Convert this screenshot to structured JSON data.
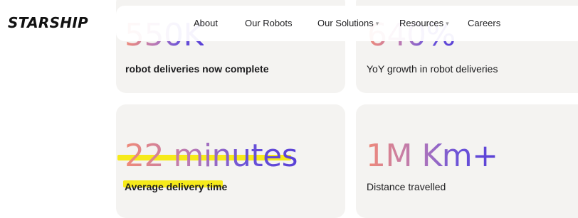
{
  "brand": {
    "name": "STARSHIP"
  },
  "nav": {
    "items": [
      {
        "label": "About"
      },
      {
        "label": "Our Robots"
      },
      {
        "label": "Our Solutions",
        "icon": "chevron-down-icon"
      },
      {
        "label": "Resources",
        "icon": "chevron-down-icon"
      },
      {
        "label": "Careers"
      }
    ],
    "chevron_glyph": "▾"
  },
  "stats": {
    "top_left": {
      "value": "550K",
      "label": "robot deliveries now complete"
    },
    "top_right": {
      "value": "640%",
      "label": "YoY growth in robot deliveries"
    },
    "bottom_left": {
      "value": "22 minutes",
      "label": "Average delivery time"
    },
    "bottom_right": {
      "value": "1M Km+",
      "label": "Distance travelled"
    }
  },
  "colors": {
    "card_background": "#f4f3f1",
    "gradient_start": "#f08a78",
    "gradient_end": "#5940d6",
    "highlight": "#f6ea1a",
    "text": "#1d1d1f"
  }
}
